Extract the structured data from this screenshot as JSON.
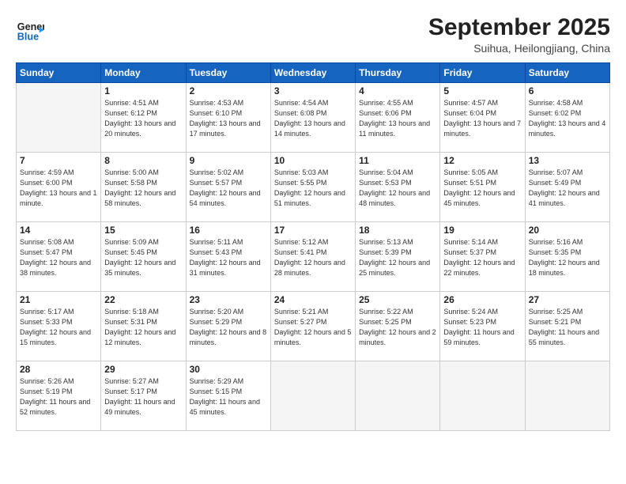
{
  "header": {
    "logo_general": "General",
    "logo_blue": "Blue",
    "month_title": "September 2025",
    "subtitle": "Suihua, Heilongjiang, China"
  },
  "days_of_week": [
    "Sunday",
    "Monday",
    "Tuesday",
    "Wednesday",
    "Thursday",
    "Friday",
    "Saturday"
  ],
  "weeks": [
    [
      {
        "day": "",
        "info": ""
      },
      {
        "day": "1",
        "info": "Sunrise: 4:51 AM\nSunset: 6:12 PM\nDaylight: 13 hours\nand 20 minutes."
      },
      {
        "day": "2",
        "info": "Sunrise: 4:53 AM\nSunset: 6:10 PM\nDaylight: 13 hours\nand 17 minutes."
      },
      {
        "day": "3",
        "info": "Sunrise: 4:54 AM\nSunset: 6:08 PM\nDaylight: 13 hours\nand 14 minutes."
      },
      {
        "day": "4",
        "info": "Sunrise: 4:55 AM\nSunset: 6:06 PM\nDaylight: 13 hours\nand 11 minutes."
      },
      {
        "day": "5",
        "info": "Sunrise: 4:57 AM\nSunset: 6:04 PM\nDaylight: 13 hours\nand 7 minutes."
      },
      {
        "day": "6",
        "info": "Sunrise: 4:58 AM\nSunset: 6:02 PM\nDaylight: 13 hours\nand 4 minutes."
      }
    ],
    [
      {
        "day": "7",
        "info": "Sunrise: 4:59 AM\nSunset: 6:00 PM\nDaylight: 13 hours\nand 1 minute."
      },
      {
        "day": "8",
        "info": "Sunrise: 5:00 AM\nSunset: 5:58 PM\nDaylight: 12 hours\nand 58 minutes."
      },
      {
        "day": "9",
        "info": "Sunrise: 5:02 AM\nSunset: 5:57 PM\nDaylight: 12 hours\nand 54 minutes."
      },
      {
        "day": "10",
        "info": "Sunrise: 5:03 AM\nSunset: 5:55 PM\nDaylight: 12 hours\nand 51 minutes."
      },
      {
        "day": "11",
        "info": "Sunrise: 5:04 AM\nSunset: 5:53 PM\nDaylight: 12 hours\nand 48 minutes."
      },
      {
        "day": "12",
        "info": "Sunrise: 5:05 AM\nSunset: 5:51 PM\nDaylight: 12 hours\nand 45 minutes."
      },
      {
        "day": "13",
        "info": "Sunrise: 5:07 AM\nSunset: 5:49 PM\nDaylight: 12 hours\nand 41 minutes."
      }
    ],
    [
      {
        "day": "14",
        "info": "Sunrise: 5:08 AM\nSunset: 5:47 PM\nDaylight: 12 hours\nand 38 minutes."
      },
      {
        "day": "15",
        "info": "Sunrise: 5:09 AM\nSunset: 5:45 PM\nDaylight: 12 hours\nand 35 minutes."
      },
      {
        "day": "16",
        "info": "Sunrise: 5:11 AM\nSunset: 5:43 PM\nDaylight: 12 hours\nand 31 minutes."
      },
      {
        "day": "17",
        "info": "Sunrise: 5:12 AM\nSunset: 5:41 PM\nDaylight: 12 hours\nand 28 minutes."
      },
      {
        "day": "18",
        "info": "Sunrise: 5:13 AM\nSunset: 5:39 PM\nDaylight: 12 hours\nand 25 minutes."
      },
      {
        "day": "19",
        "info": "Sunrise: 5:14 AM\nSunset: 5:37 PM\nDaylight: 12 hours\nand 22 minutes."
      },
      {
        "day": "20",
        "info": "Sunrise: 5:16 AM\nSunset: 5:35 PM\nDaylight: 12 hours\nand 18 minutes."
      }
    ],
    [
      {
        "day": "21",
        "info": "Sunrise: 5:17 AM\nSunset: 5:33 PM\nDaylight: 12 hours\nand 15 minutes."
      },
      {
        "day": "22",
        "info": "Sunrise: 5:18 AM\nSunset: 5:31 PM\nDaylight: 12 hours\nand 12 minutes."
      },
      {
        "day": "23",
        "info": "Sunrise: 5:20 AM\nSunset: 5:29 PM\nDaylight: 12 hours\nand 8 minutes."
      },
      {
        "day": "24",
        "info": "Sunrise: 5:21 AM\nSunset: 5:27 PM\nDaylight: 12 hours\nand 5 minutes."
      },
      {
        "day": "25",
        "info": "Sunrise: 5:22 AM\nSunset: 5:25 PM\nDaylight: 12 hours\nand 2 minutes."
      },
      {
        "day": "26",
        "info": "Sunrise: 5:24 AM\nSunset: 5:23 PM\nDaylight: 11 hours\nand 59 minutes."
      },
      {
        "day": "27",
        "info": "Sunrise: 5:25 AM\nSunset: 5:21 PM\nDaylight: 11 hours\nand 55 minutes."
      }
    ],
    [
      {
        "day": "28",
        "info": "Sunrise: 5:26 AM\nSunset: 5:19 PM\nDaylight: 11 hours\nand 52 minutes."
      },
      {
        "day": "29",
        "info": "Sunrise: 5:27 AM\nSunset: 5:17 PM\nDaylight: 11 hours\nand 49 minutes."
      },
      {
        "day": "30",
        "info": "Sunrise: 5:29 AM\nSunset: 5:15 PM\nDaylight: 11 hours\nand 45 minutes."
      },
      {
        "day": "",
        "info": ""
      },
      {
        "day": "",
        "info": ""
      },
      {
        "day": "",
        "info": ""
      },
      {
        "day": "",
        "info": ""
      }
    ]
  ]
}
